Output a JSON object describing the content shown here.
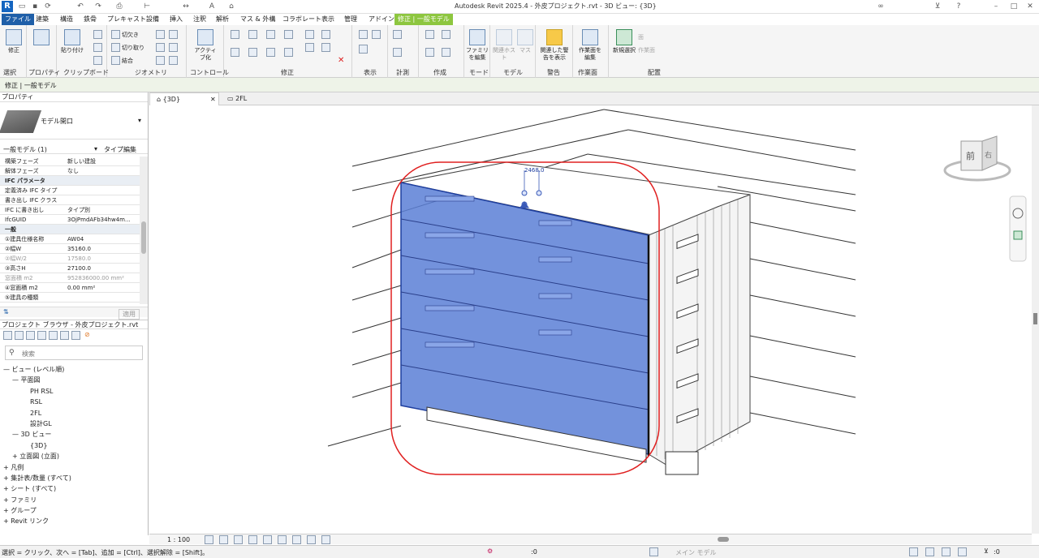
{
  "app": {
    "title": "Autodesk Revit 2025.4 - 外皮プロジェクト.rvt - 3D ビュー: {3D}",
    "logo": "R"
  },
  "ribbon_tabs": [
    "ファイル",
    "建築",
    "構造",
    "鉄骨",
    "プレキャスト",
    "設備",
    "挿入",
    "注釈",
    "解析",
    "マス & 外構",
    "コラボレート",
    "表示",
    "管理",
    "アドイン",
    "修正 | 一般モデル"
  ],
  "ribbon": {
    "modify_label": "修正",
    "select_label": "選択",
    "properties_label": "プロパティ",
    "clipboard": {
      "paste_label": "貼り付け",
      "panel": "クリップボード"
    },
    "geometry": {
      "cut": "切り取り",
      "join": "結合",
      "cope": "切欠き",
      "panel": "ジオメトリ"
    },
    "controls": {
      "activate": "アクティブ化",
      "panel": "コントロール"
    },
    "modify_panel": "修正",
    "view_panel": "表示",
    "measure_panel": "計測",
    "create_panel": "作成",
    "mode": {
      "edit_family": "ファミリを編集",
      "panel": "モード"
    },
    "model": {
      "edit_host": "関連ホスト",
      "mass": "マス",
      "panel": "モデル"
    },
    "warning": {
      "show_warnings": "関連した警告を表示",
      "panel": "警告"
    },
    "workplane": {
      "edit_workplane": "作業面を編集",
      "panel": "作業面"
    },
    "placement": {
      "new_select": "新規選択",
      "panel": "配置",
      "plane": "面",
      "workplane": "作業面"
    }
  },
  "options_bar": {
    "text": "修正 | 一般モデル"
  },
  "properties": {
    "header": "プロパティ",
    "type_name": "モデル開口",
    "selector": "一般モデル (1)",
    "edit_type": "タイプ編集",
    "rows": [
      {
        "k": "構築フェーズ",
        "v": "新しい建設",
        "type": "row"
      },
      {
        "k": "解体フェーズ",
        "v": "なし",
        "type": "row"
      },
      {
        "k": "IFC パラメータ",
        "v": "",
        "type": "sec"
      },
      {
        "k": "定義済み IFC タイプ",
        "v": "",
        "type": "row"
      },
      {
        "k": "書き出し IFC クラス",
        "v": "",
        "type": "row"
      },
      {
        "k": "IFC に書き出し",
        "v": "タイプ別",
        "type": "row"
      },
      {
        "k": "IfcGUID",
        "v": "3OjPmdAFb34hw4m...",
        "type": "row"
      },
      {
        "k": "一般",
        "v": "",
        "type": "sec"
      },
      {
        "k": "①建具仕様名称",
        "v": "AW04",
        "type": "row"
      },
      {
        "k": "②幅W",
        "v": "35160.0",
        "type": "row"
      },
      {
        "k": "②幅W/2",
        "v": "17580.0",
        "type": "grey"
      },
      {
        "k": "③高さH",
        "v": "27100.0",
        "type": "row"
      },
      {
        "k": "窓面積 m2",
        "v": "952836000.00 mm²",
        "type": "grey"
      },
      {
        "k": "④窓面積 m2",
        "v": "0.00 mm²",
        "type": "row"
      },
      {
        "k": "⑤建具の種類",
        "v": "",
        "type": "row"
      }
    ],
    "apply": "適用"
  },
  "browser": {
    "header": "プロジェクト ブラウザ - 外皮プロジェクト.rvt",
    "search_placeholder": "検索",
    "items": [
      {
        "label": "ビュー (レベル順)",
        "indent": 0,
        "prefix": "—"
      },
      {
        "label": "平面図",
        "indent": 1,
        "prefix": "—"
      },
      {
        "label": "PH RSL",
        "indent": 3,
        "prefix": ""
      },
      {
        "label": "RSL",
        "indent": 3,
        "prefix": ""
      },
      {
        "label": "2FL",
        "indent": 3,
        "prefix": ""
      },
      {
        "label": "設計GL",
        "indent": 3,
        "prefix": ""
      },
      {
        "label": "3D ビュー",
        "indent": 1,
        "prefix": "—"
      },
      {
        "label": "{3D}",
        "indent": 3,
        "prefix": ""
      },
      {
        "label": "立面図 (立面)",
        "indent": 1,
        "prefix": "+"
      },
      {
        "label": "凡例",
        "indent": 0,
        "prefix": "+"
      },
      {
        "label": "集計表/数量 (すべて)",
        "indent": 0,
        "prefix": "+"
      },
      {
        "label": "シート (すべて)",
        "indent": 0,
        "prefix": "+"
      },
      {
        "label": "ファミリ",
        "indent": 0,
        "prefix": "+"
      },
      {
        "label": "グループ",
        "indent": 0,
        "prefix": "+"
      },
      {
        "label": "Revit リンク",
        "indent": 0,
        "prefix": "+"
      }
    ]
  },
  "view_tabs": [
    "{3D}",
    "2FL"
  ],
  "canvas": {
    "dimension": "2468.0",
    "viewcube_front": "前",
    "viewcube_right": "右",
    "highlight_color": "#e02020",
    "selection_color": "#5b7fd6"
  },
  "view_control": {
    "scale": "1 : 100"
  },
  "status": {
    "text": "選択 = クリック、次へ = [Tab]、追加 = [Ctrl]、選択解除 = [Shift]。",
    "model": "メイン モデル",
    "filter": ":0"
  },
  "colors": {
    "file_tab": "#1f5fa8",
    "context_tab": "#8dc63f",
    "options_bar": "#eef3e8"
  }
}
